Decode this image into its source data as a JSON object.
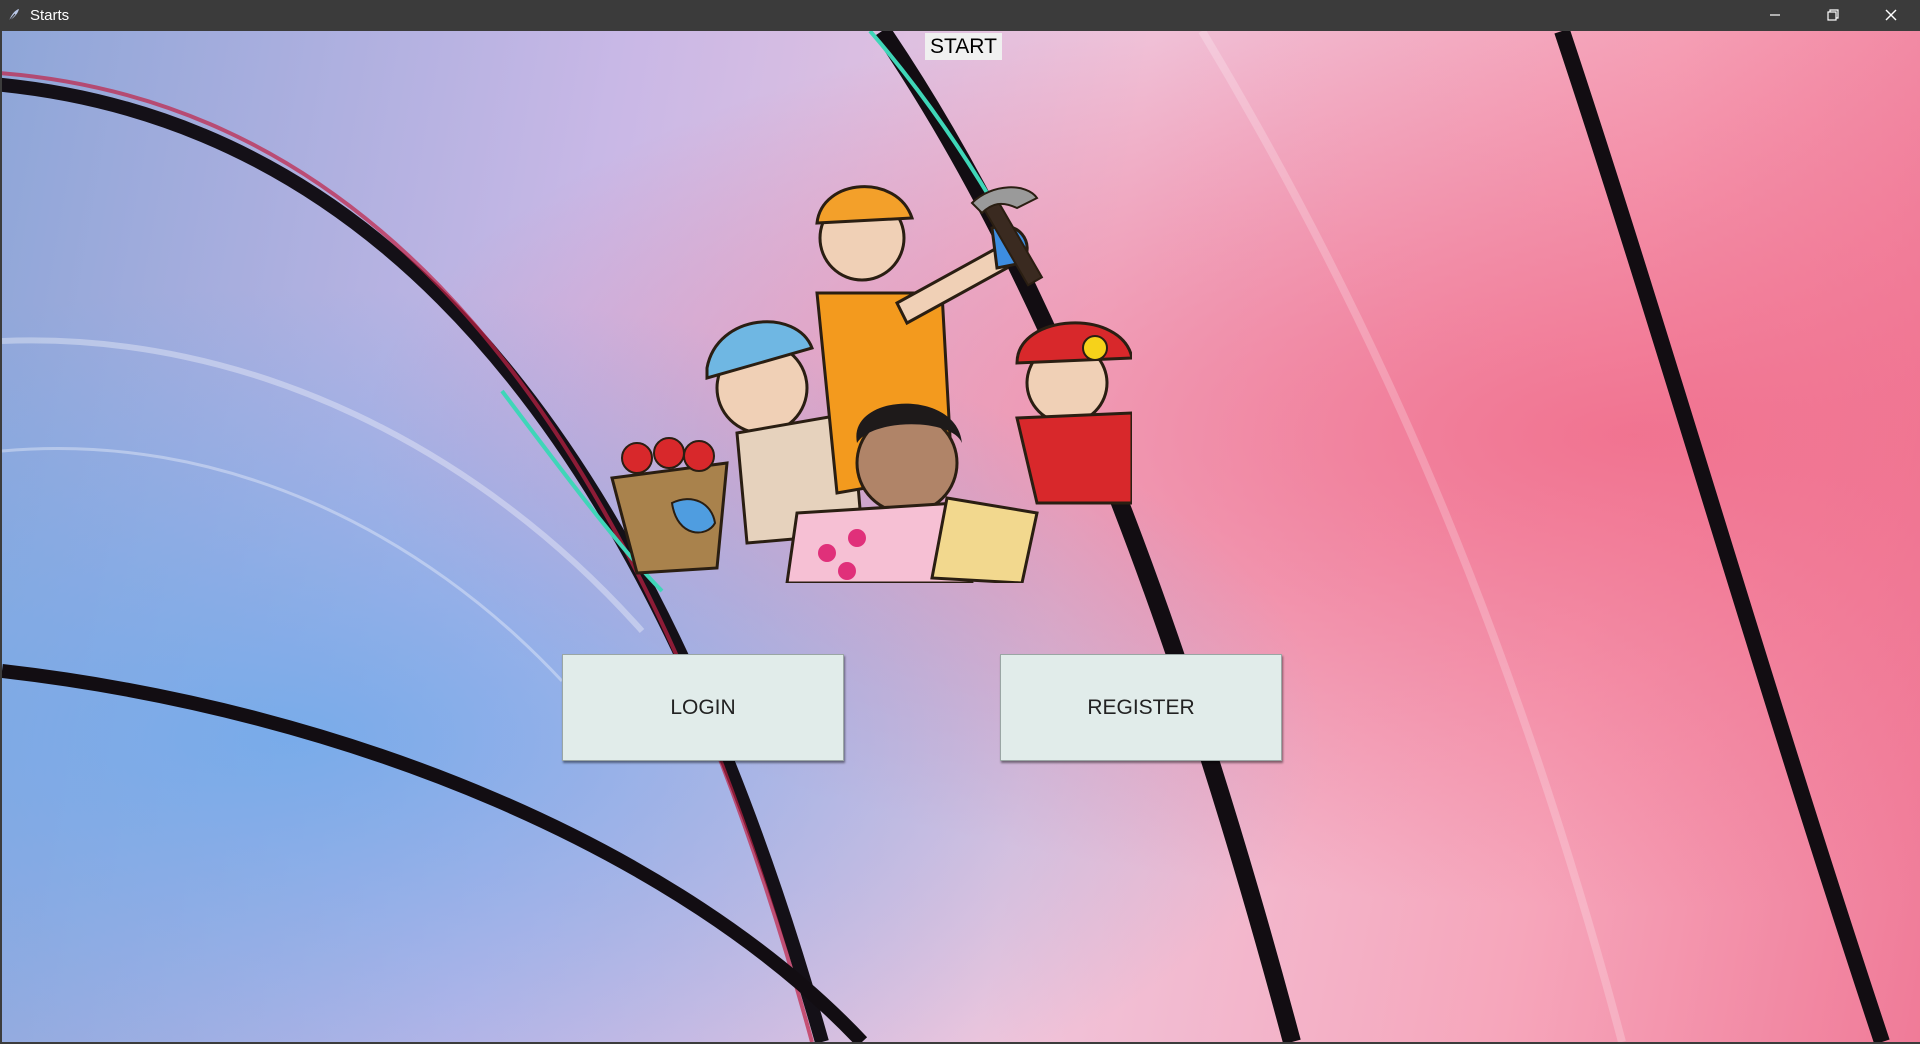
{
  "window": {
    "title": "Starts"
  },
  "header": {
    "start_label": "START"
  },
  "actions": {
    "login_label": "LOGIN",
    "register_label": "REGISTER"
  },
  "colors": {
    "titlebar": "#3b3b3b",
    "button_bg": "#e1ecea",
    "start_bg": "#f0f0f0"
  }
}
